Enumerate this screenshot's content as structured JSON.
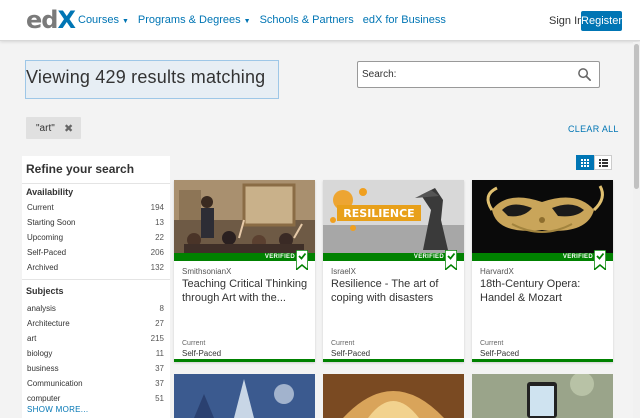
{
  "header": {
    "logo_ed": "ed",
    "logo_x": "X",
    "nav": [
      {
        "label": "Courses",
        "has_caret": true
      },
      {
        "label": "Programs & Degrees",
        "has_caret": true
      },
      {
        "label": "Schools & Partners",
        "has_caret": false
      },
      {
        "label": "edX for Business",
        "has_caret": false
      }
    ],
    "signin": "Sign In",
    "register": "Register"
  },
  "results": {
    "title": "Viewing 429 results matching"
  },
  "search": {
    "placeholder": "Search:"
  },
  "filter_chip": {
    "label": "\"art\"",
    "remove": "✖"
  },
  "clear_all": "CLEAR ALL",
  "sidebar": {
    "title": "Refine your search",
    "availability": {
      "title": "Availability",
      "items": [
        {
          "label": "Current",
          "count": "194"
        },
        {
          "label": "Starting Soon",
          "count": "13"
        },
        {
          "label": "Upcoming",
          "count": "22"
        },
        {
          "label": "Self-Paced",
          "count": "206"
        },
        {
          "label": "Archived",
          "count": "132"
        }
      ]
    },
    "subjects": {
      "title": "Subjects",
      "items": [
        {
          "label": "analysis",
          "count": "8"
        },
        {
          "label": "Architecture",
          "count": "27"
        },
        {
          "label": "art",
          "count": "215"
        },
        {
          "label": "biology",
          "count": "11"
        },
        {
          "label": "business",
          "count": "37"
        },
        {
          "label": "Communication",
          "count": "37"
        },
        {
          "label": "computer",
          "count": "51"
        }
      ]
    },
    "show_more": "SHOW MORE..."
  },
  "cards": [
    {
      "org": "SmithsonianX",
      "title": "Teaching Critical Thinking through Art with the...",
      "verified": "VERIFIED",
      "status": "Current",
      "pace": "Self-Paced"
    },
    {
      "org": "IsraelX",
      "title": "Resilience - The art of coping with disasters",
      "verified": "VERIFIED",
      "status": "Current",
      "pace": "Self-Paced",
      "image_text": "RESILIENCE"
    },
    {
      "org": "HarvardX",
      "title": "18th-Century Opera: Handel & Mozart",
      "verified": "VERIFIED",
      "status": "Current",
      "pace": "Self-Paced"
    }
  ],
  "colors": {
    "accent": "#0075b4",
    "verified": "#008100"
  }
}
